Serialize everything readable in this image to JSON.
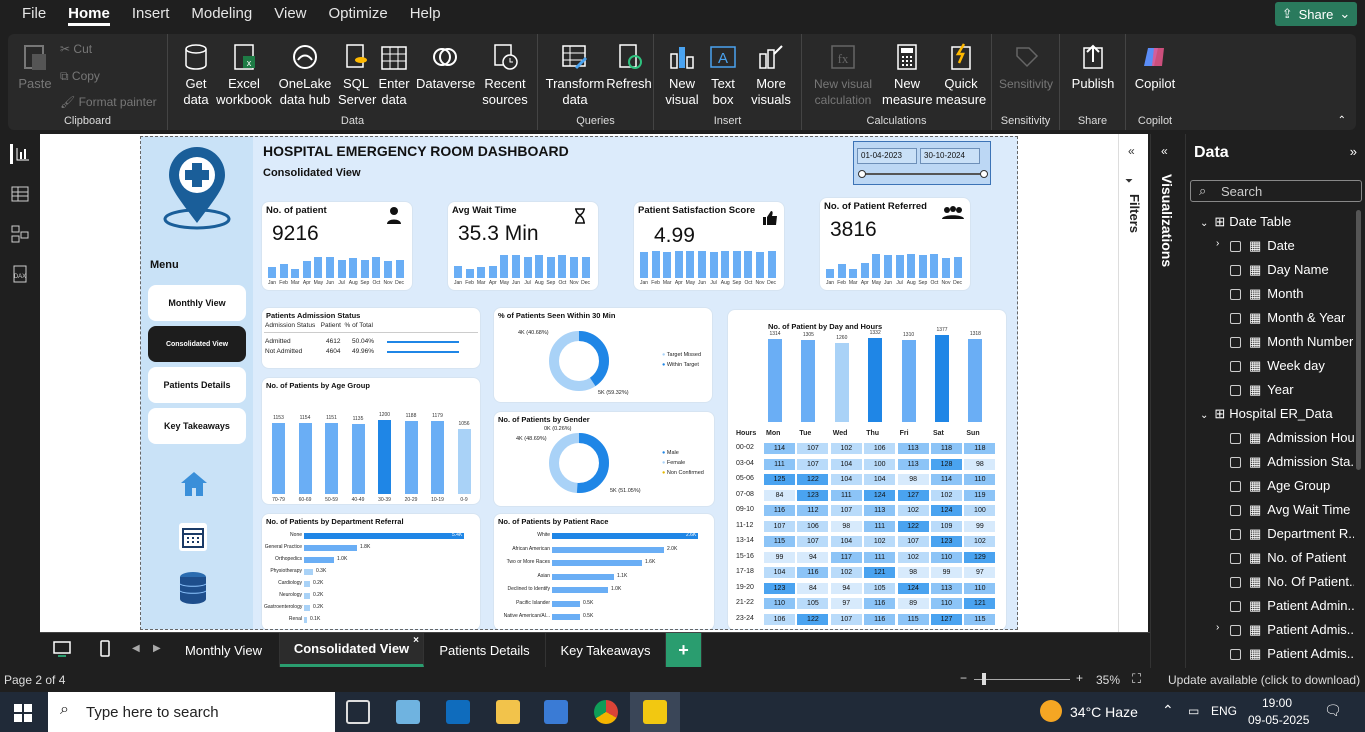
{
  "menu": [
    "File",
    "Home",
    "Insert",
    "Modeling",
    "View",
    "Optimize",
    "Help"
  ],
  "share_label": "Share",
  "ribbon": {
    "clipboard": {
      "name": "Clipboard",
      "paste": "Paste",
      "cut": "Cut",
      "copy": "Copy",
      "format": "Format painter"
    },
    "data": {
      "name": "Data",
      "get": "Get data",
      "excel": "Excel workbook",
      "onelake": "OneLake data hub",
      "sql": "SQL Server",
      "enter": "Enter data",
      "dataverse": "Dataverse",
      "recent": "Recent sources"
    },
    "queries": {
      "name": "Queries",
      "transform": "Transform data",
      "refresh": "Refresh"
    },
    "insert": {
      "name": "Insert",
      "newvisual": "New visual",
      "textbox": "Text box",
      "more": "More visuals"
    },
    "calc": {
      "name": "Calculations",
      "nvc": "New visual calculation",
      "nm": "New measure",
      "qm": "Quick measure"
    },
    "sens": {
      "name": "Sensitivity",
      "label": "Sensitivity"
    },
    "share": {
      "name": "Share",
      "publish": "Publish"
    },
    "copilot": {
      "name": "Copilot",
      "label": "Copilot"
    }
  },
  "report": {
    "title": "HOSPITAL EMERGENCY ROOM  DASHBOARD",
    "subtitle": "Consolidated View",
    "date_from": "01-04-2023",
    "date_to": "30-10-2024",
    "menu_label": "Menu",
    "nav": [
      "Monthly View",
      "Consolidated View",
      "Patients Details",
      "Key Takeaways"
    ],
    "kpis": [
      {
        "title": "No. of patient",
        "value": "9216"
      },
      {
        "title": "Avg Wait Time",
        "value": "35.3 Min"
      },
      {
        "title": "Patient Satisfaction Score",
        "value": "4.99"
      },
      {
        "title": "No. of Patient Referred",
        "value": "3816"
      }
    ],
    "months": [
      "Jan",
      "Feb",
      "Mar",
      "Apr",
      "May",
      "Jun",
      "Jul",
      "Aug",
      "Sep",
      "Oct",
      "Nov",
      "Dec"
    ],
    "admission": {
      "title": "Patients Admission Status",
      "headers": [
        "Admission Status",
        "Patient",
        "% of Total"
      ],
      "rows": [
        [
          "Admitted",
          "4612",
          "50.04%"
        ],
        [
          "Not Admitted",
          "4604",
          "49.96%"
        ]
      ]
    },
    "wait30": {
      "title": "% of Patients Seen Within 30 Min",
      "l1": "4K (40.68%)",
      "l2": "5K (59.32%)",
      "legend": [
        "Target Missed",
        "Within Target"
      ]
    },
    "gender": {
      "title": "No. of Patients by Gender",
      "l0": "0K (0.26%)",
      "l1": "4K (48.69%)",
      "l2": "5K (51.05%)",
      "legend": [
        "Male",
        "Female",
        "Non Confirmed"
      ]
    },
    "age": {
      "title": "No. of Patients by Age Group"
    },
    "dept": {
      "title": "No. of Patients by Department Referral"
    },
    "race": {
      "title": "No. of Patients by Patient Race"
    },
    "dayhour": {
      "title": "No. of Patient by Day and Hours",
      "hours_label": "Hours"
    }
  },
  "chart_data": [
    {
      "type": "bar",
      "title": "No. of Patients by Age Group",
      "categories": [
        "70-79",
        "60-69",
        "50-59",
        "40-49",
        "30-39",
        "20-29",
        "10-19",
        "0-9"
      ],
      "values": [
        1153,
        1154,
        1151,
        1135,
        1200,
        1188,
        1179,
        1056
      ]
    },
    {
      "type": "bar",
      "title": "No. of Patients by Department Referral",
      "categories": [
        "None",
        "General Practice",
        "Orthopedics",
        "Physiotherapy",
        "Cardiology",
        "Neurology",
        "Gastroenterology",
        "Renal"
      ],
      "values": [
        5.4,
        1.8,
        1.0,
        0.3,
        0.2,
        0.2,
        0.2,
        0.1
      ],
      "labels": [
        "5.4K",
        "1.8K",
        "1.0K",
        "0.3K",
        "0.2K",
        "0.2K",
        "0.2K",
        "0.1K"
      ]
    },
    {
      "type": "bar",
      "title": "No. of Patients by Patient Race",
      "categories": [
        "White",
        "African American",
        "Two or More Races",
        "Asian",
        "Declined to Identify",
        "Pacific Islander",
        "Native American/Al..."
      ],
      "values": [
        2.6,
        2.0,
        1.6,
        1.1,
        1.0,
        0.5,
        0.5
      ],
      "labels": [
        "2.6K",
        "2.0K",
        "1.6K",
        "1.1K",
        "1.0K",
        "0.5K",
        "0.5K"
      ]
    },
    {
      "type": "bar",
      "title": "No. of Patient by Day and Hours",
      "categories": [
        "Mon",
        "Tue",
        "Wed",
        "Thu",
        "Fri",
        "Sat",
        "Sun"
      ],
      "values": [
        1314,
        1305,
        1260,
        1332,
        1310,
        1377,
        1318
      ]
    },
    {
      "type": "table",
      "hours": [
        "00-02",
        "03-04",
        "05-06",
        "07-08",
        "09-10",
        "11-12",
        "13-14",
        "15-16",
        "17-18",
        "19-20",
        "21-22",
        "23-24"
      ],
      "rows": [
        [
          114,
          107,
          102,
          106,
          113,
          118,
          118
        ],
        [
          111,
          107,
          104,
          100,
          113,
          128,
          98
        ],
        [
          125,
          122,
          104,
          104,
          98,
          114,
          110
        ],
        [
          84,
          123,
          111,
          124,
          127,
          102,
          119
        ],
        [
          116,
          112,
          107,
          113,
          102,
          124,
          100
        ],
        [
          107,
          106,
          98,
          111,
          122,
          109,
          99
        ],
        [
          115,
          107,
          104,
          102,
          107,
          123,
          102
        ],
        [
          99,
          94,
          117,
          111,
          102,
          110,
          129
        ],
        [
          104,
          116,
          102,
          121,
          98,
          99,
          97
        ],
        [
          123,
          84,
          94,
          105,
          124,
          113,
          110
        ],
        [
          110,
          105,
          97,
          116,
          89,
          110,
          121
        ],
        [
          106,
          122,
          107,
          116,
          115,
          127,
          115
        ]
      ]
    }
  ],
  "filters_label": "Filters",
  "viz_label": "Visualizations",
  "datapane": {
    "title": "Data",
    "search": "Search",
    "items": [
      "Date Table",
      "Date",
      "Day Name",
      "Month",
      "Month & Year",
      "Month Number",
      "Week day",
      "Year",
      "Hospital ER_Data",
      "Admission Hour",
      "Admission Sta...",
      "Age Group",
      "Avg Wait Time",
      "Department R...",
      "No. of Patient",
      "No. Of Patient...",
      "Patient Admin...",
      "Patient Admis...",
      "Patient Admis..."
    ]
  },
  "tabs": [
    "Monthly View",
    "Consolidated View",
    "Patients Details",
    "Key Takeaways"
  ],
  "status": {
    "page": "Page 2 of 4",
    "zoom": "35%",
    "update": "Update available (click to download)"
  },
  "taskbar": {
    "search": "Type here to search",
    "weather": "34°C  Haze",
    "lang": "ENG",
    "time": "19:00",
    "date": "09-05-2025"
  }
}
